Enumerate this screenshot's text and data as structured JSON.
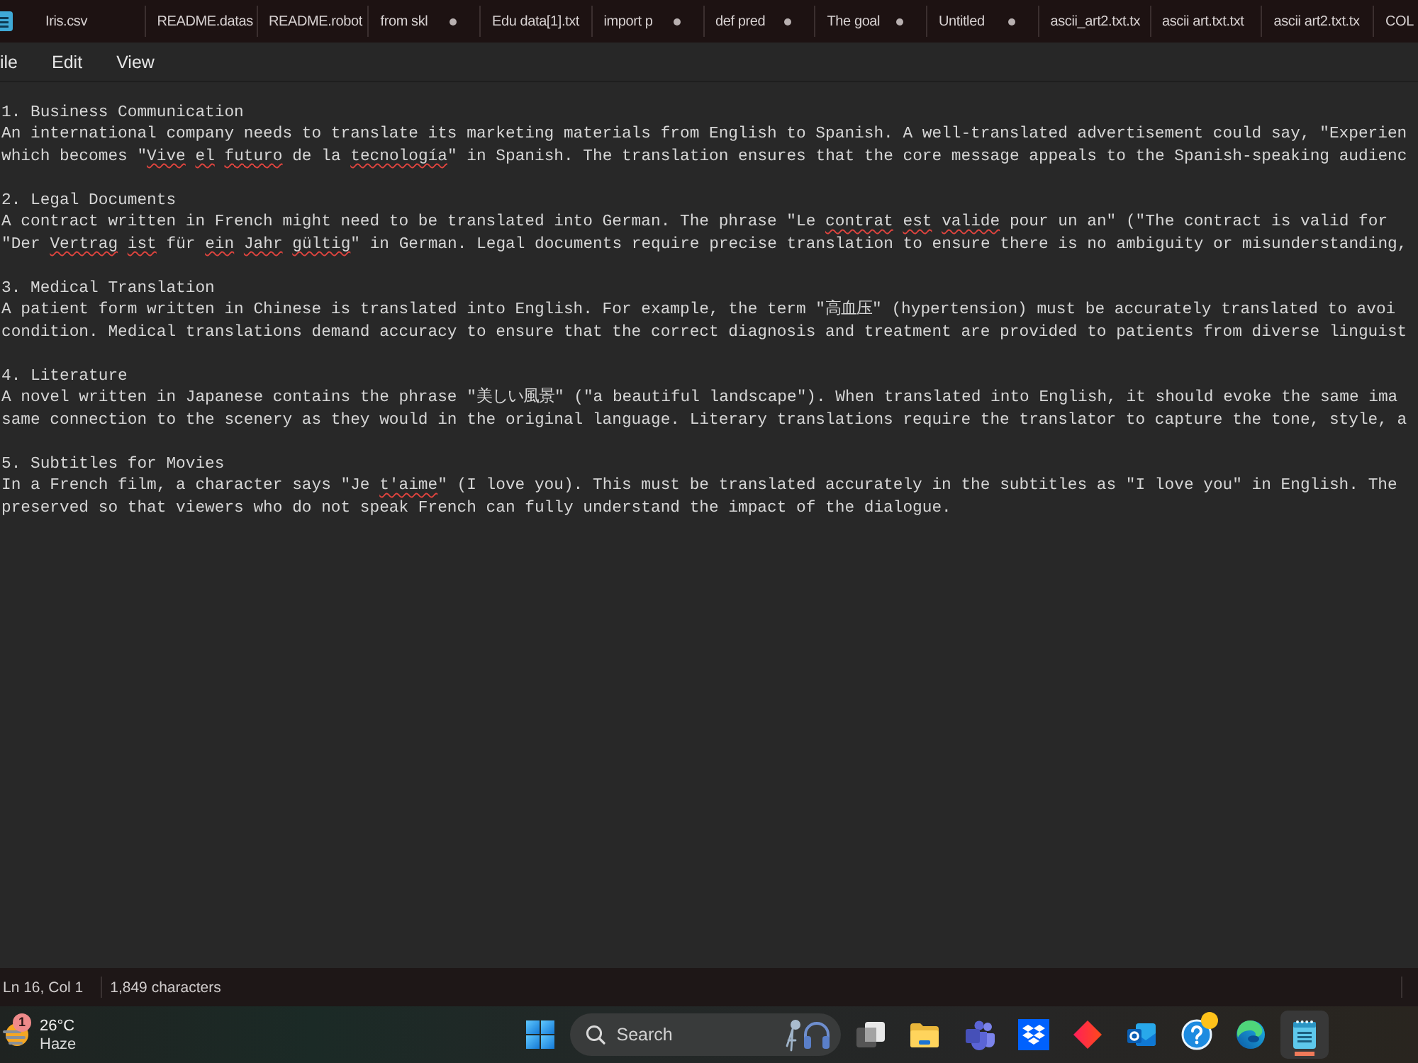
{
  "tabs": [
    {
      "label": "Iris.csv",
      "modified": false
    },
    {
      "label": "README.datas",
      "modified": false
    },
    {
      "label": "README.robot",
      "modified": false
    },
    {
      "label": "from skl",
      "modified": true
    },
    {
      "label": "Edu data[1].txt",
      "modified": false
    },
    {
      "label": "import p",
      "modified": true
    },
    {
      "label": "def pred",
      "modified": true
    },
    {
      "label": "The goal",
      "modified": true
    },
    {
      "label": "Untitled",
      "modified": true
    },
    {
      "label": "ascii_art2.txt.tx",
      "modified": false
    },
    {
      "label": "ascii art.txt.txt",
      "modified": false
    },
    {
      "label": "ascii art2.txt.tx",
      "modified": false
    },
    {
      "label": "COL",
      "modified": false
    }
  ],
  "menu": [
    "ile",
    "Edit",
    "View"
  ],
  "editor": {
    "sections": [
      {
        "heading": "1. Business Communication",
        "lines": [
          {
            "segments": [
              {
                "text": "An international company needs to translate its marketing materials from English to Spanish. A well-translated advertisement could say, \"Experien",
                "misspelled": false
              }
            ]
          },
          {
            "segments": [
              {
                "text": "which becomes \"",
                "misspelled": false
              },
              {
                "text": "Vive el futuro",
                "misspelled": true
              },
              {
                "text": " de la ",
                "misspelled": false
              },
              {
                "text": "tecnología",
                "misspelled": true
              },
              {
                "text": "\" in Spanish. The translation ensures that the core message appeals to the Spanish-speaking audienc",
                "misspelled": false
              }
            ]
          }
        ]
      },
      {
        "heading": "2. Legal Documents",
        "lines": [
          {
            "segments": [
              {
                "text": "A contract written in French might need to be translated into German. The phrase \"Le ",
                "misspelled": false
              },
              {
                "text": "contrat est valide",
                "misspelled": true
              },
              {
                "text": " pour un an\" (\"The contract is valid for",
                "misspelled": false
              }
            ]
          },
          {
            "segments": [
              {
                "text": "\"Der ",
                "misspelled": false
              },
              {
                "text": "Vertrag ist",
                "misspelled": true
              },
              {
                "text": " für ",
                "misspelled": false
              },
              {
                "text": "ein Jahr gültig",
                "misspelled": true
              },
              {
                "text": "\" in German. Legal documents require precise translation to ensure there is no ambiguity or misunderstanding,",
                "misspelled": false
              }
            ]
          }
        ]
      },
      {
        "heading": "3. Medical Translation",
        "lines": [
          {
            "segments": [
              {
                "text": "A patient form written in Chinese is translated into English. For example, the term \"高血压\" (hypertension) must be accurately translated to avoi",
                "misspelled": false
              }
            ]
          },
          {
            "segments": [
              {
                "text": "condition. Medical translations demand accuracy to ensure that the correct diagnosis and treatment are provided to patients from diverse linguist",
                "misspelled": false
              }
            ]
          }
        ]
      },
      {
        "heading": "4. Literature",
        "lines": [
          {
            "segments": [
              {
                "text": "A novel written in Japanese contains the phrase \"美しい風景\" (\"a beautiful landscape\"). When translated into English, it should evoke the same ima",
                "misspelled": false
              }
            ]
          },
          {
            "segments": [
              {
                "text": "same connection to the scenery as they would in the original language. Literary translations require the translator to capture the tone, style, a",
                "misspelled": false
              }
            ]
          }
        ]
      },
      {
        "heading": "5. Subtitles for Movies",
        "lines": [
          {
            "segments": [
              {
                "text": "In a French film, a character says \"Je ",
                "misspelled": false
              },
              {
                "text": "t'aime",
                "misspelled": true
              },
              {
                "text": "\" (I love you). This must be translated accurately in the subtitles as \"I love you\" in English. The",
                "misspelled": false
              }
            ]
          },
          {
            "segments": [
              {
                "text": "preserved so that viewers who do not speak French can fully understand the impact of the dialogue.",
                "misspelled": false
              }
            ]
          }
        ]
      }
    ]
  },
  "status_bar": {
    "position": "Ln 16, Col 1",
    "characters": "1,849 characters"
  },
  "taskbar": {
    "weather": {
      "badge": "1",
      "temperature": "26°C",
      "condition": "Haze"
    },
    "search": {
      "placeholder": "Search"
    },
    "apps": [
      {
        "kind": "task-view",
        "active": false,
        "notification": false
      },
      {
        "kind": "folder",
        "active": false,
        "notification": false
      },
      {
        "kind": "people",
        "active": false,
        "notification": false
      },
      {
        "kind": "box",
        "active": false,
        "notification": false
      },
      {
        "kind": "diamond",
        "active": false,
        "notification": false
      },
      {
        "kind": "mail",
        "active": false,
        "notification": false
      },
      {
        "kind": "help",
        "active": false,
        "notification": true
      },
      {
        "kind": "swirl",
        "active": false,
        "notification": false
      },
      {
        "kind": "notepad",
        "active": true,
        "notification": false
      }
    ]
  }
}
